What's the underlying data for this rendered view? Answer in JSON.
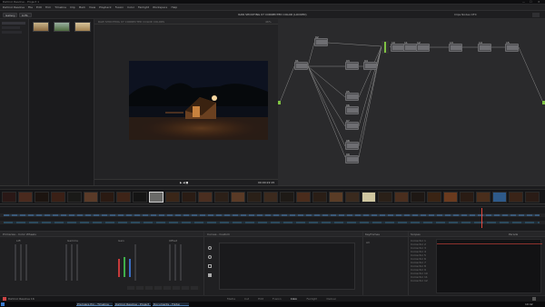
{
  "window": {
    "title": "DaVinci Resolve - Project 1",
    "minimize": "—",
    "maximize": "☐",
    "close": "✕"
  },
  "menu": [
    "DaVinci Resolve",
    "File",
    "Edit",
    "Trim",
    "Timeline",
    "Clip",
    "Mark",
    "View",
    "Playback",
    "Fusion",
    "Color",
    "Fairlight",
    "Workspace",
    "Help"
  ],
  "toolbar": {
    "gallery": "Gallery",
    "luts": "LUTs",
    "center_title": "RAW SHOOTING 07 CORRECTED COLOR (LOCKED)",
    "clip_name": "RAW SHOOTING 07 CORRECTED COLOR COLORS",
    "zoom": "46%",
    "right": "Clips  Nodes  OFX"
  },
  "viewer": {
    "timecode": "00:00:22:15"
  },
  "nodes": {
    "labels": [
      "01",
      "02",
      "03",
      "04",
      "05",
      "06",
      "07",
      "08",
      "09",
      "10",
      "11",
      "12",
      "13",
      "14",
      "15"
    ]
  },
  "panels": {
    "wheels_title": "Primaries - Color Wheels",
    "wheels": [
      "Lift",
      "Gamma",
      "Gain",
      "Offset"
    ],
    "curves_title": "Curves - Custom",
    "keyframes_title": "Keyframes",
    "keyframes_label": "All",
    "scopes_title": "Scopes",
    "scopes_mode": "Parade",
    "list_items": [
      "Corrector 1",
      "Corrector 2",
      "Corrector 3",
      "Corrector 4",
      "Corrector 5",
      "Corrector 6",
      "Corrector 7",
      "Corrector 8",
      "Corrector 9",
      "Corrector 10",
      "Corrector 11",
      "Corrector 12"
    ]
  },
  "pages": [
    "Media",
    "Cut",
    "Edit",
    "Fusion",
    "Color",
    "Fairlight",
    "Deliver"
  ],
  "app_version": "DaVinci Resolve 16",
  "taskbar": {
    "items": [
      "Premiere Pro - Timeline",
      "DaVinci Resolve - Project",
      "Documents - Folder"
    ],
    "time": "10:42"
  }
}
